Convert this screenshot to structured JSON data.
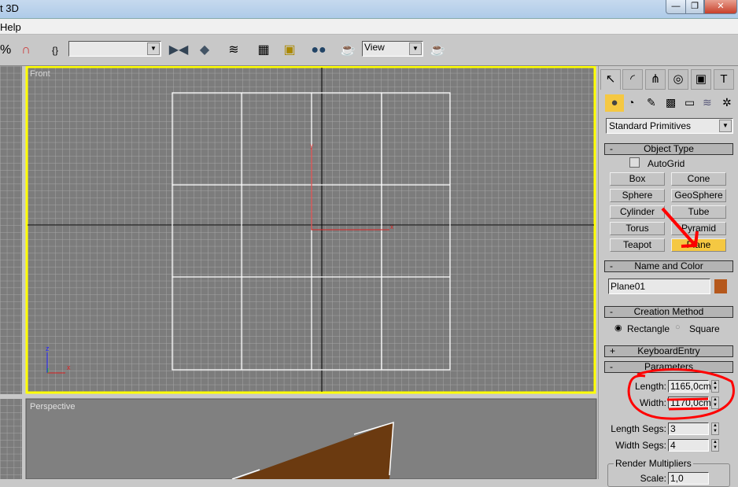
{
  "window": {
    "title": "t 3D",
    "minimize": "—",
    "restore": "❐",
    "close": "✕"
  },
  "menu": {
    "items": [
      "Help"
    ]
  },
  "toolbar": {
    "selection_set_value": "",
    "view_dropdown": "View",
    "icons": [
      "percent-snap-icon",
      "spinner-snap-icon",
      "named-selection-icon",
      "mirror-icon",
      "align-icon",
      "layer-manager-icon",
      "curve-editor-icon",
      "schematic-view-icon",
      "material-editor-icon",
      "render-setup-icon",
      "render-icon"
    ]
  },
  "viewports": {
    "front": {
      "label": "Front",
      "axes": {
        "z": "z",
        "x": "x",
        "y": "y"
      }
    },
    "perspective": {
      "label": "Perspective"
    },
    "active_border": "#ffff00",
    "plane_color": "#6b3a10"
  },
  "command_panel": {
    "tabs": [
      "create",
      "modify",
      "hierarchy",
      "motion",
      "display",
      "utilities"
    ],
    "categories": [
      "geometry",
      "shapes",
      "lights",
      "cameras",
      "helpers",
      "space-warps",
      "systems"
    ],
    "primitive_type": "Standard Primitives",
    "object_type": {
      "title": "Object Type",
      "autogrid": "AutoGrid",
      "buttons": [
        "Box",
        "Cone",
        "Sphere",
        "GeoSphere",
        "Cylinder",
        "Tube",
        "Torus",
        "Pyramid",
        "Teapot",
        "Plane"
      ],
      "active": "Plane"
    },
    "name_and_color": {
      "title": "Name and Color",
      "name": "Plane01",
      "color": "#b5581c"
    },
    "creation_method": {
      "title": "Creation Method",
      "options": [
        "Rectangle",
        "Square"
      ],
      "selected": "Rectangle"
    },
    "keyboard_entry": {
      "title": "KeyboardEntry"
    },
    "parameters": {
      "title": "Parameters",
      "length_label": "Length:",
      "length": "1165,0cm",
      "width_label": "Width:",
      "width": "1170,0cm",
      "length_segs_label": "Length Segs:",
      "length_segs": "3",
      "width_segs_label": "Width Segs:",
      "width_segs": "4",
      "render_multipliers": "Render Multipliers",
      "scale_label": "Scale:",
      "scale": "1,0"
    },
    "collapse_sign": "-",
    "expand_sign": "+"
  },
  "annotation_color": "#ff0000"
}
